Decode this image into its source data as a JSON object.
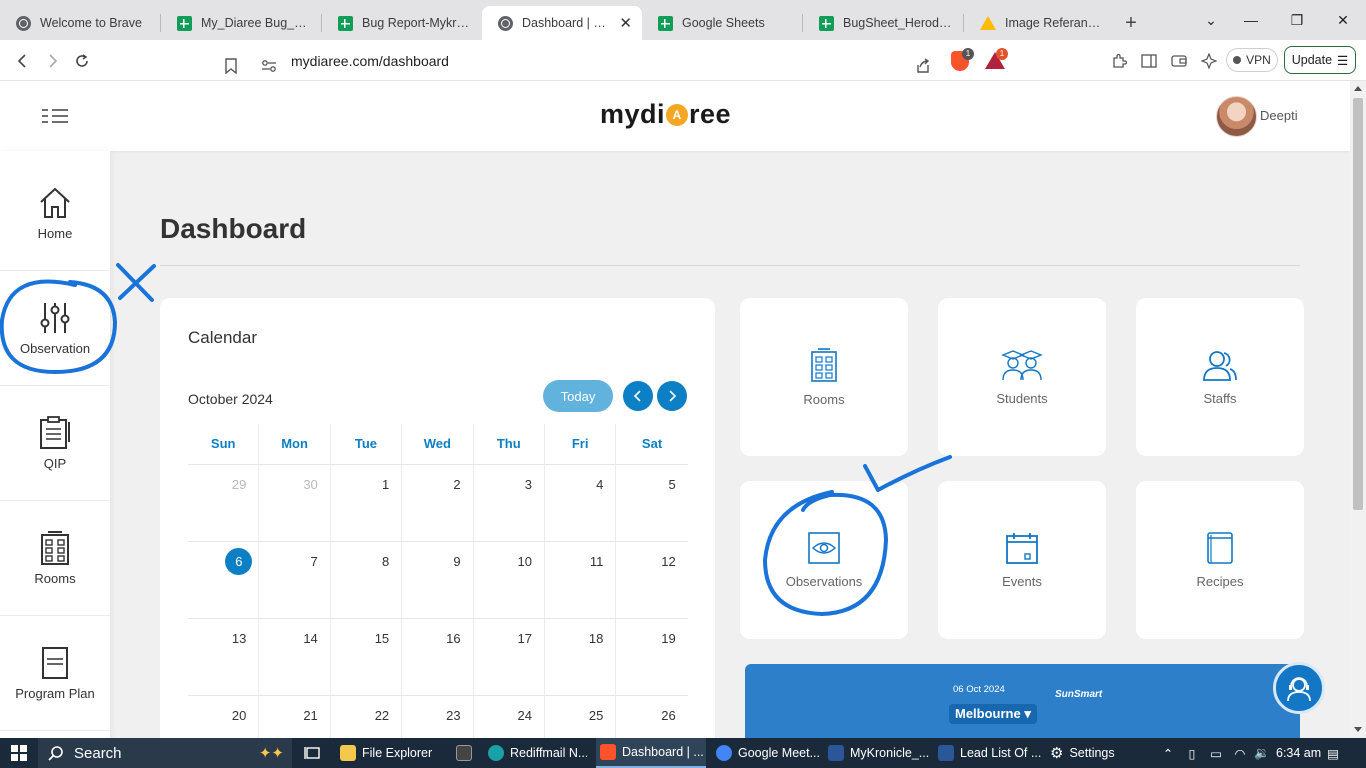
{
  "browser": {
    "tabs": [
      {
        "title": "Welcome to Brave",
        "icon": "globe-icon",
        "active": false
      },
      {
        "title": "My_Diaree Bug_Sheet",
        "icon": "sheets-icon",
        "active": false
      },
      {
        "title": "Bug Report-Mykronicle",
        "icon": "sheets-icon",
        "active": false
      },
      {
        "title": "Dashboard | Mydiaree",
        "icon": "globe-icon",
        "active": true
      },
      {
        "title": "Google Sheets",
        "icon": "sheets-icon",
        "active": false
      },
      {
        "title": "BugSheet_Herody_Admin",
        "icon": "sheets-icon",
        "active": false
      },
      {
        "title": "Image Referances Mydiaree",
        "icon": "drive-icon",
        "active": false
      }
    ],
    "url": "mydiaree.com/dashboard",
    "brave_shield_count": "1",
    "rewards_count": "1",
    "vpn_label": "VPN",
    "update_label": "Update"
  },
  "app": {
    "logo_left": "mydi",
    "logo_mark": "A",
    "logo_right": "ree",
    "username": "Deepti"
  },
  "sidebar": {
    "items": [
      {
        "label": "Home",
        "icon": "home-icon"
      },
      {
        "label": "Observation",
        "icon": "sliders-icon"
      },
      {
        "label": "QIP",
        "icon": "clipboard-icon"
      },
      {
        "label": "Rooms",
        "icon": "building-icon"
      },
      {
        "label": "Program Plan",
        "icon": "document-icon"
      }
    ]
  },
  "main": {
    "page_title": "Dashboard"
  },
  "calendar": {
    "heading": "Calendar",
    "month": "October 2024",
    "today_label": "Today",
    "weekdays": [
      "Sun",
      "Mon",
      "Tue",
      "Wed",
      "Thu",
      "Fri",
      "Sat"
    ],
    "weeks": [
      [
        {
          "d": "29",
          "other": true
        },
        {
          "d": "30",
          "other": true
        },
        {
          "d": "1"
        },
        {
          "d": "2"
        },
        {
          "d": "3"
        },
        {
          "d": "4"
        },
        {
          "d": "5"
        }
      ],
      [
        {
          "d": "6",
          "today": true
        },
        {
          "d": "7"
        },
        {
          "d": "8"
        },
        {
          "d": "9"
        },
        {
          "d": "10"
        },
        {
          "d": "11"
        },
        {
          "d": "12"
        }
      ],
      [
        {
          "d": "13"
        },
        {
          "d": "14"
        },
        {
          "d": "15"
        },
        {
          "d": "16"
        },
        {
          "d": "17"
        },
        {
          "d": "18"
        },
        {
          "d": "19"
        }
      ],
      [
        {
          "d": "20"
        },
        {
          "d": "21"
        },
        {
          "d": "22"
        },
        {
          "d": "23"
        },
        {
          "d": "24"
        },
        {
          "d": "25"
        },
        {
          "d": "26"
        }
      ]
    ]
  },
  "tiles": [
    {
      "label": "Rooms",
      "icon": "building-icon"
    },
    {
      "label": "Students",
      "icon": "graduates-icon"
    },
    {
      "label": "Staffs",
      "icon": "users-icon"
    },
    {
      "label": "Observations",
      "icon": "eye-icon"
    },
    {
      "label": "Events",
      "icon": "calendar-icon"
    },
    {
      "label": "Recipes",
      "icon": "book-icon"
    }
  ],
  "weather": {
    "date": "06 Oct 2024",
    "city": "Melbourne",
    "brand": "SunSmart"
  },
  "taskbar": {
    "search_label": "Search",
    "items": [
      {
        "label": "File Explorer",
        "color": "#f2c94c"
      },
      {
        "label": "",
        "color": "#444444"
      },
      {
        "label": "Rediffmail N...",
        "color": "#1aa1a8"
      },
      {
        "label": "Dashboard | ...",
        "color": "#fb542b"
      },
      {
        "label": "Google Meet...",
        "color": "#4285f4"
      },
      {
        "label": "MyKronicle_...",
        "color": "#2b579a"
      },
      {
        "label": "Lead List Of ...",
        "color": "#2b579a"
      },
      {
        "label": "Settings",
        "color": "#888888"
      }
    ],
    "time": "6:34 am"
  },
  "colors": {
    "accent": "#0d7fc4",
    "annotation": "#1a73d9",
    "sheets": "#0f9d58",
    "brave": "#fb542b"
  }
}
